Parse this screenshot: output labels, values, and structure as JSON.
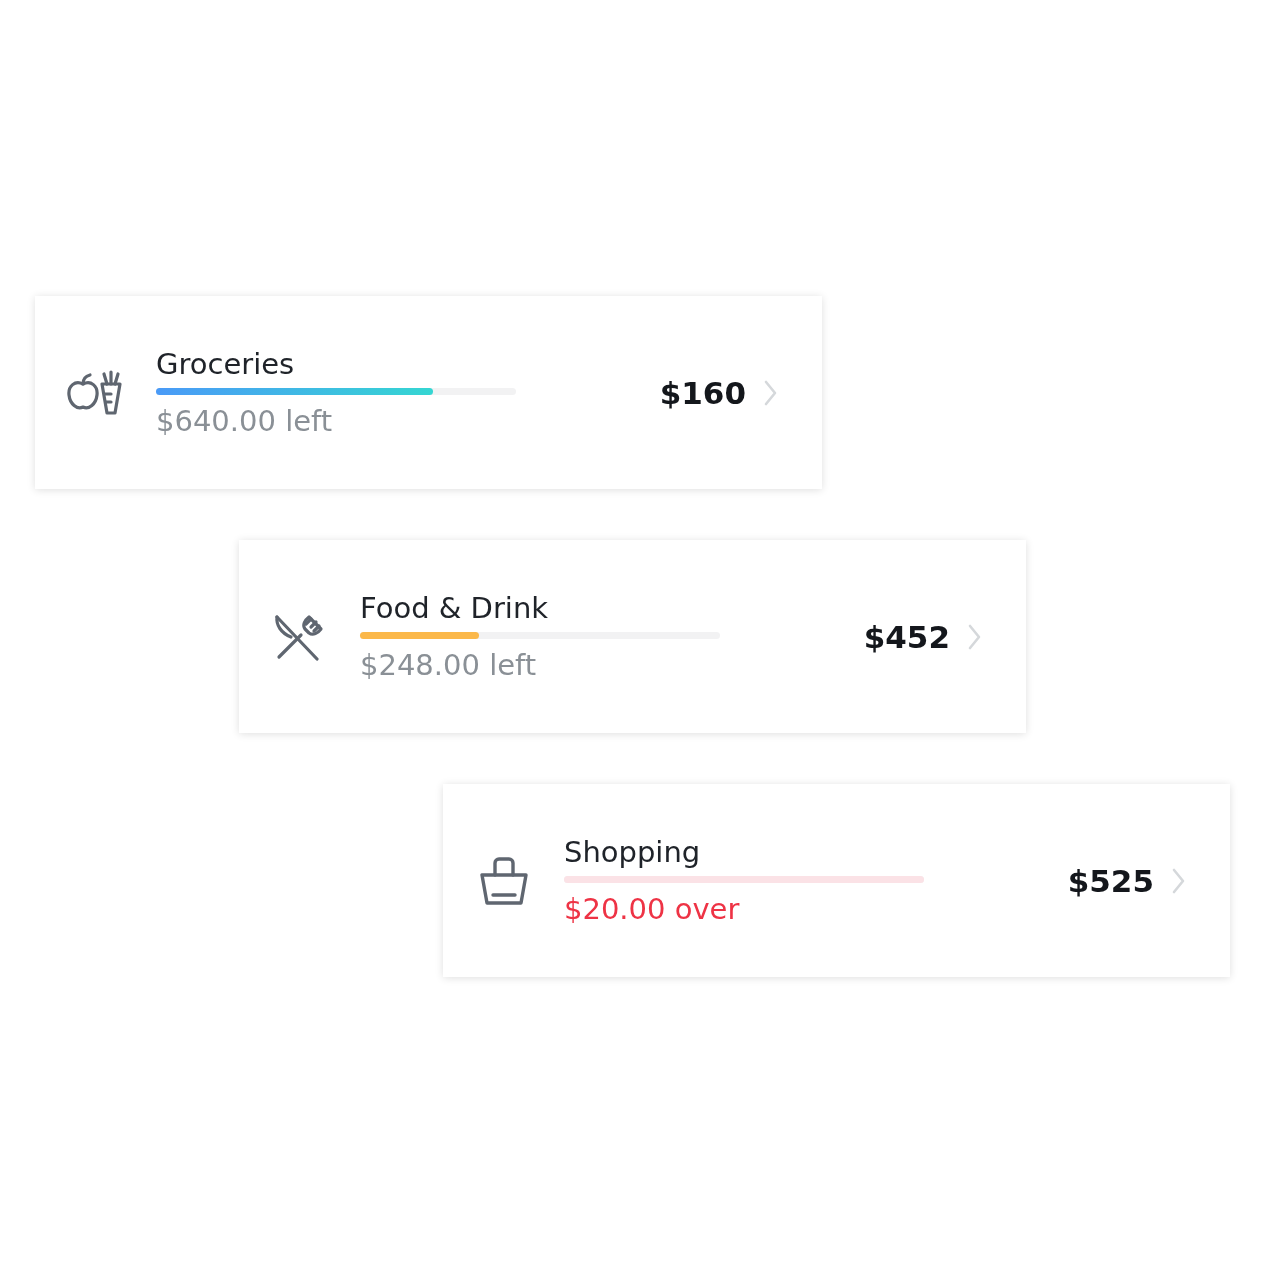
{
  "budgets": [
    {
      "kind": "groceries",
      "name": "Groceries",
      "level": 0.77,
      "color": "#35d6d2",
      "over": false,
      "remaining": "$640.00 left",
      "amount": "$160"
    },
    {
      "kind": "food",
      "name": "Food & Drink",
      "level": 0.33,
      "color": "#fbb84a",
      "over": false,
      "remaining": "$248.00 left",
      "amount": "$452"
    },
    {
      "kind": "shopping",
      "name": "Shopping",
      "level": 1,
      "color": "#fbe2e6",
      "over": true,
      "remaining": "$20.00 over",
      "amount": "$525"
    }
  ]
}
